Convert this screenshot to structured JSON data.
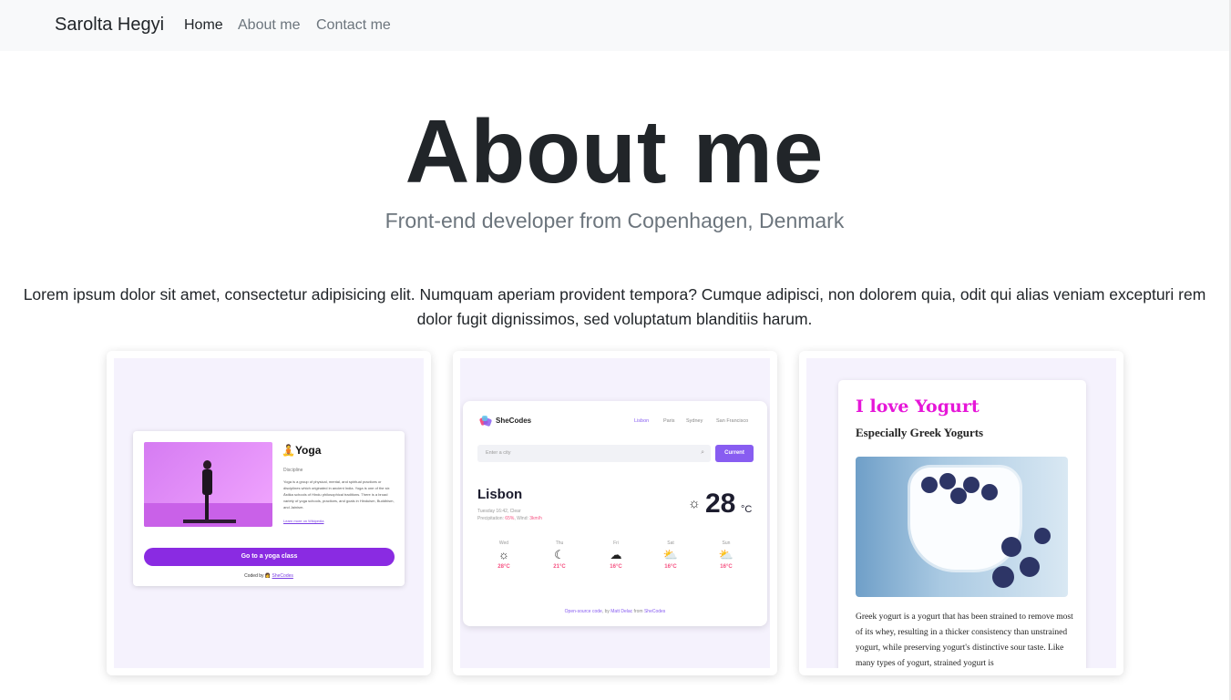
{
  "nav": {
    "brand": "Sarolta Hegyi",
    "links": [
      "Home",
      "About me",
      "Contact me"
    ]
  },
  "hero": {
    "title": "About me",
    "subtitle": "Front-end developer from Copenhagen, Denmark"
  },
  "intro": "Lorem ipsum dolor sit amet, consectetur adipisicing elit. Numquam aperiam provident tempora? Cumque adipisci, non dolorem quia, odit qui alias veniam excepturi rem dolor fugit dignissimos, sed voluptatum blanditiis harum.",
  "projects": {
    "yoga": {
      "title": "🧘Yoga",
      "discipline": "Discipline",
      "description": "Yoga is a group of physical, mental, and spiritual practices or disciplines which originated in ancient India. Yoga is one of the six Āstika schools of Hindu philosophical traditions. There is a broad variety of yoga schools, practices, and goals in Hinduism, Buddhism, and Jainism.",
      "link": "Learn more on Wikipedia",
      "button": "Go to a yoga class",
      "credit_prefix": "Coded by 👩 ",
      "credit_link": "SheCodes"
    },
    "weather": {
      "logo": "SheCodes",
      "tabs": [
        "Lisbon",
        "Paris",
        "Sydney",
        "San Francisco"
      ],
      "search_placeholder": "Enter a city",
      "search_icon": "search-icon",
      "button": "Current",
      "city": "Lisbon",
      "datetime": "Tuesday 16:42, Clear",
      "precip_label": "Precipitation: ",
      "precip": "65%",
      "wind_label": ", Wind: ",
      "wind": "3km/h",
      "temp": "28",
      "unit": "°C",
      "forecast": [
        {
          "day": "Wed",
          "icon": "☼",
          "temp": "28°C"
        },
        {
          "day": "Thu",
          "icon": "☾",
          "temp": "21°C"
        },
        {
          "day": "Fri",
          "icon": "☁",
          "temp": "16°C"
        },
        {
          "day": "Sat",
          "icon": "⛅",
          "temp": "16°C"
        },
        {
          "day": "Sun",
          "icon": "⛅",
          "temp": "16°C"
        }
      ],
      "credit_a": "Open-source code",
      "credit_b": ", by ",
      "credit_c": "Matt Delac",
      "credit_d": " from ",
      "credit_e": "SheCodes"
    },
    "yogurt": {
      "title": "I love Yogurt",
      "subtitle": "Especially Greek Yogurts",
      "text": "Greek yogurt is a yogurt that has been strained to remove most of its whey, resulting in a thicker consistency than unstrained yogurt, while preserving yogurt's distinctive sour taste. Like many types of yogurt, strained yogurt is"
    }
  },
  "colors": {
    "nav_bg": "#f8f9fa",
    "yoga_accent": "#8a2be2",
    "weather_accent": "#885df1",
    "weather_pink": "#f65282",
    "yogurt_title": "#e616d8"
  }
}
